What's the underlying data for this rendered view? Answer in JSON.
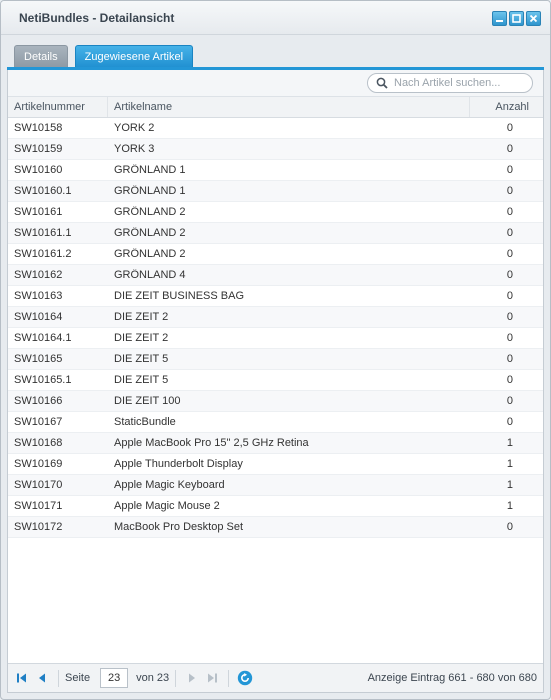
{
  "window": {
    "title": "NetiBundles - Detailansicht"
  },
  "tabs": [
    {
      "label": "Details",
      "active": false
    },
    {
      "label": "Zugewiesene Artikel",
      "active": true
    }
  ],
  "search": {
    "placeholder": "Nach Artikel suchen...",
    "value": ""
  },
  "grid": {
    "columns": [
      "Artikelnummer",
      "Artikelname",
      "Anzahl"
    ],
    "rows": [
      [
        "SW10158",
        "YORK 2",
        "0"
      ],
      [
        "SW10159",
        "YORK 3",
        "0"
      ],
      [
        "SW10160",
        "GRÖNLAND 1",
        "0"
      ],
      [
        "SW10160.1",
        "GRÖNLAND 1",
        "0"
      ],
      [
        "SW10161",
        "GRÖNLAND 2",
        "0"
      ],
      [
        "SW10161.1",
        "GRÖNLAND 2",
        "0"
      ],
      [
        "SW10161.2",
        "GRÖNLAND 2",
        "0"
      ],
      [
        "SW10162",
        "GRÖNLAND 4",
        "0"
      ],
      [
        "SW10163",
        "DIE ZEIT BUSINESS BAG",
        "0"
      ],
      [
        "SW10164",
        "DIE ZEIT 2",
        "0"
      ],
      [
        "SW10164.1",
        "DIE ZEIT 2",
        "0"
      ],
      [
        "SW10165",
        "DIE ZEIT 5",
        "0"
      ],
      [
        "SW10165.1",
        "DIE ZEIT 5",
        "0"
      ],
      [
        "SW10166",
        "DIE ZEIT 100",
        "0"
      ],
      [
        "SW10167",
        "StaticBundle",
        "0"
      ],
      [
        "SW10168",
        "Apple MacBook Pro 15\" 2,5 GHz Retina",
        "1"
      ],
      [
        "SW10169",
        "Apple Thunderbolt Display",
        "1"
      ],
      [
        "SW10170",
        "Apple Magic Keyboard",
        "1"
      ],
      [
        "SW10171",
        "Apple Magic Mouse 2",
        "1"
      ],
      [
        "SW10172",
        "MacBook Pro Desktop Set",
        "0"
      ]
    ]
  },
  "pager": {
    "page_label": "Seite",
    "page_value": "23",
    "of_label": "von 23",
    "info": "Anzeige Eintrag 661 - 680 von 680"
  },
  "colors": {
    "accent": "#2396d6",
    "tab_inactive": "#97a3ae"
  }
}
